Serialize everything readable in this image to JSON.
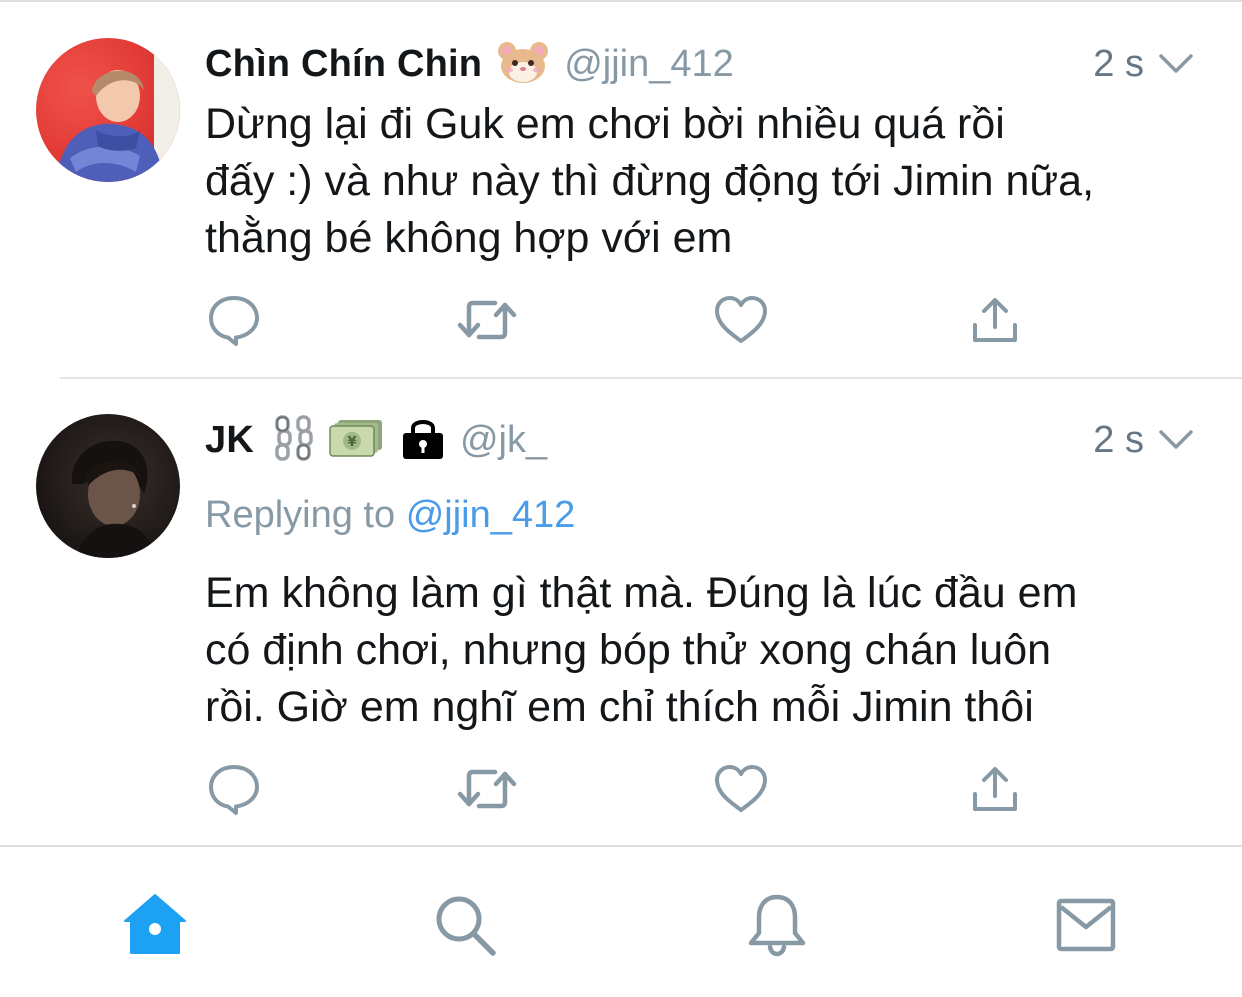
{
  "colors": {
    "accent": "#1da1f2",
    "icon_gray": "#8899a6",
    "text": "#14171a",
    "mention": "#4a9ce8"
  },
  "tweets": [
    {
      "display_name": "Chìn Chín Chin",
      "name_emoji": [
        "hamster-face"
      ],
      "handle": "@jjin_412",
      "time": "2 s",
      "text_lines": [
        "Dừng lại đi Guk em chơi bời nhiều quá rồi",
        "đấy :) và như này thì đừng động tới Jimin nữa,",
        "thằng bé không hợp với em"
      ]
    },
    {
      "display_name": "JK",
      "name_emoji": [
        "chains",
        "yen-banknote",
        "lock"
      ],
      "handle": "@jk_",
      "time": "2 s",
      "reply_prefix": "Replying to",
      "reply_mention": "@jjin_412",
      "text_lines": [
        "Em không làm gì thật mà. Đúng là lúc đầu em",
        "có định chơi, nhưng bóp thử xong chán luôn",
        "rồi. Giờ em nghĩ em chỉ thích mỗi Jimin thôi"
      ]
    }
  ],
  "action_icons": [
    "reply-icon",
    "retweet-icon",
    "like-icon",
    "share-icon"
  ],
  "tabbar": [
    "home-icon",
    "search-icon",
    "notifications-icon",
    "messages-icon"
  ],
  "active_tab": "home"
}
